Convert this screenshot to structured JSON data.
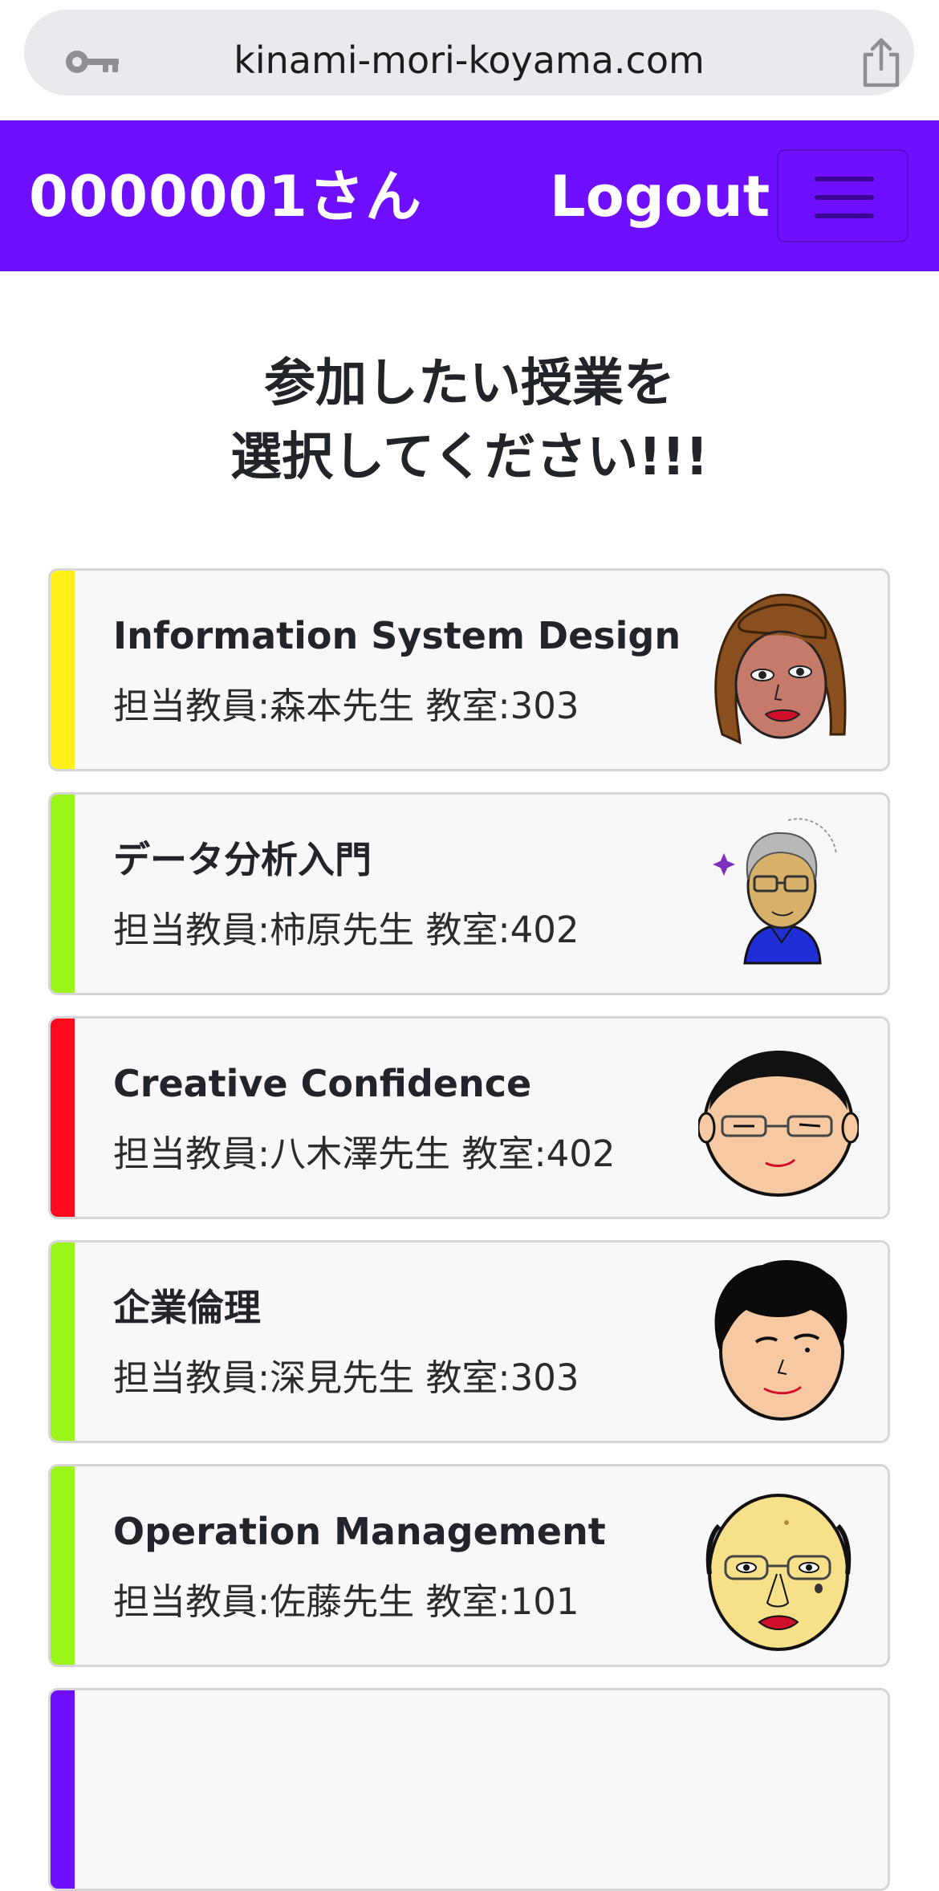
{
  "browser": {
    "url": "kinami-mori-koyama.com",
    "lock_icon": "key-icon",
    "share_icon": "share-icon"
  },
  "navbar": {
    "user_label": "0000001さん",
    "logout_label": "Logout",
    "menu_icon": "hamburger-menu-icon",
    "color": "#6e0fff"
  },
  "heading": {
    "line1": "参加したい授業を",
    "line2": "選択してください!!!"
  },
  "courses": [
    {
      "title": "Information System Design",
      "meta": "担当教員:森本先生 教室:303",
      "accent": "#fff01a",
      "avatar": "teacher-avatar-long-brown-hair"
    },
    {
      "title": "データ分析入門",
      "meta": "担当教員:柿原先生 教室:402",
      "accent": "#9cf51a",
      "avatar": "teacher-avatar-gray-hair-glasses"
    },
    {
      "title": "Creative Confidence",
      "meta": "担当教員:八木澤先生 教室:402",
      "accent": "#ff0a1c",
      "avatar": "teacher-avatar-round-face-glasses"
    },
    {
      "title": "企業倫理",
      "meta": "担当教員:深見先生 教室:303",
      "accent": "#9cf51a",
      "avatar": "teacher-avatar-black-hair"
    },
    {
      "title": "Operation Management",
      "meta": "担当教員:佐藤先生 教室:101",
      "accent": "#9cf51a",
      "avatar": "teacher-avatar-bald-glasses"
    },
    {
      "accent": "#6e0fff"
    }
  ]
}
